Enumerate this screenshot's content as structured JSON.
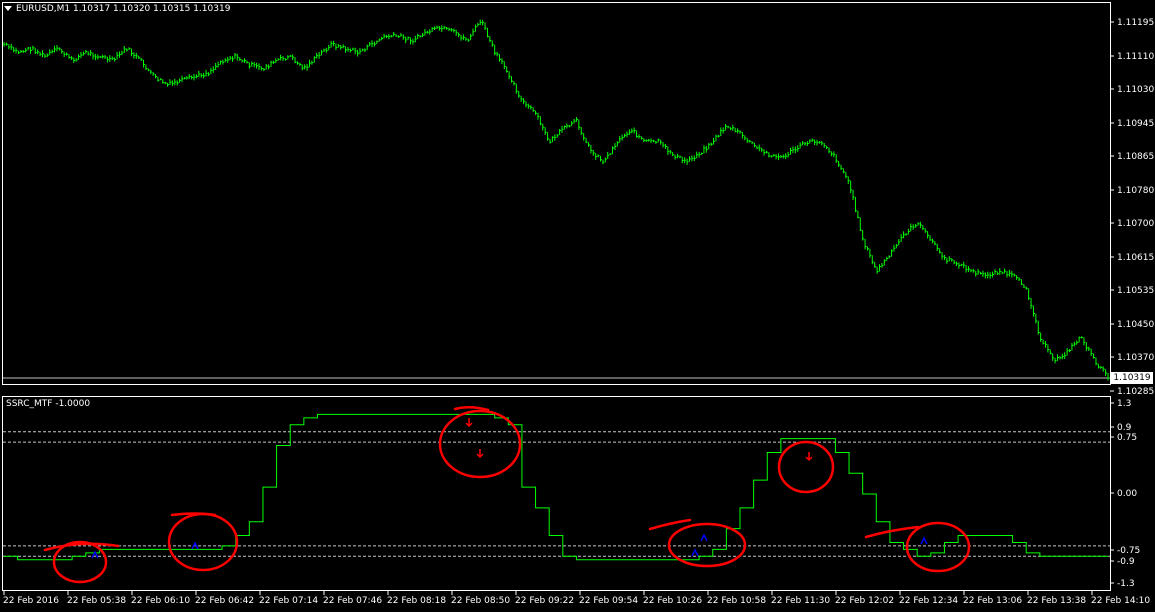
{
  "main_chart": {
    "symbol_header": "EURUSD,M1  1.10317 1.10320 1.10315 1.10319",
    "price_labels": [
      "1.11195",
      "1.11110",
      "1.11030",
      "1.10945",
      "1.10865",
      "1.10780",
      "1.10700",
      "1.10615",
      "1.10535",
      "1.10450",
      "1.10370",
      "1.10285"
    ],
    "current_price": "1.10319",
    "colors": {
      "background": "#000000",
      "candles": "#00ff00",
      "axis": "#ffffff"
    }
  },
  "indicator": {
    "title": "SSRC_MTF -1.0000",
    "levels_labels": [
      "1.3",
      "0.9",
      "0.75",
      "0.00",
      "-0.75",
      "-0.9",
      "-1.3"
    ],
    "line_color": "#00ff00",
    "arrow_up_color": "#0000ff",
    "arrow_down_color": "#ff0000",
    "annotation_color": "#ff0000"
  },
  "time_axis": {
    "labels": [
      "22 Feb 2016",
      "22 Feb 05:38",
      "22 Feb 06:10",
      "22 Feb 06:42",
      "22 Feb 07:14",
      "22 Feb 07:46",
      "22 Feb 08:18",
      "22 Feb 08:50",
      "22 Feb 09:22",
      "22 Feb 09:54",
      "22 Feb 10:26",
      "22 Feb 10:58",
      "22 Feb 11:30",
      "22 Feb 12:02",
      "22 Feb 12:34",
      "22 Feb 13:06",
      "22 Feb 13:38",
      "22 Feb 14:10"
    ]
  },
  "chart_data": [
    {
      "type": "line",
      "title": "EURUSD,M1",
      "series": [
        {
          "name": "EURUSD",
          "values": [
            1.1114,
            1.1112,
            1.1113,
            1.1111,
            1.1113,
            1.111,
            1.1112,
            1.1111,
            1.111,
            1.1113,
            1.111,
            1.1106,
            1.1104,
            1.1105,
            1.1106,
            1.1107,
            1.111,
            1.1111,
            1.1109,
            1.1108,
            1.111,
            1.1111,
            1.1108,
            1.1111,
            1.1114,
            1.1113,
            1.1112,
            1.1114,
            1.1116,
            1.1116,
            1.1115,
            1.1117,
            1.1118,
            1.1117,
            1.1115,
            1.112,
            1.1112,
            1.1107,
            1.11,
            1.1097,
            1.109,
            1.1093,
            1.1095,
            1.1088,
            1.1085,
            1.109,
            1.1093,
            1.109,
            1.109,
            1.1087,
            1.1085,
            1.1087,
            1.109,
            1.1094,
            1.1092,
            1.1089,
            1.1087,
            1.1086,
            1.1088,
            1.109,
            1.109,
            1.1086,
            1.108,
            1.1066,
            1.1058,
            1.1062,
            1.1067,
            1.107,
            1.1066,
            1.1061,
            1.106,
            1.1058,
            1.1057,
            1.1058,
            1.1057,
            1.1054,
            1.1042,
            1.1036,
            1.1038,
            1.1042,
            1.1036,
            1.1032
          ]
        }
      ],
      "ylim": [
        1.10285,
        1.11195
      ]
    },
    {
      "type": "line",
      "title": "SSRC_MTF -1.0000",
      "series": [
        {
          "name": "SSRC_MTF",
          "values": [
            -0.9,
            -0.95,
            -0.95,
            -0.95,
            -0.95,
            -0.9,
            -0.85,
            -0.8,
            -0.8,
            -0.8,
            -0.8,
            -0.8,
            -0.8,
            -0.8,
            -0.8,
            -0.8,
            -0.75,
            -0.6,
            -0.4,
            0.1,
            0.7,
            1.0,
            1.1,
            1.15,
            1.15,
            1.15,
            1.15,
            1.15,
            1.15,
            1.15,
            1.15,
            1.15,
            1.15,
            1.15,
            1.15,
            1.15,
            1.1,
            1.0,
            0.1,
            -0.2,
            -0.6,
            -0.9,
            -0.95,
            -0.95,
            -0.95,
            -0.95,
            -0.95,
            -0.95,
            -0.95,
            -0.95,
            -0.95,
            -0.9,
            -0.8,
            -0.5,
            -0.2,
            0.2,
            0.6,
            0.8,
            0.8,
            0.8,
            0.8,
            0.6,
            0.3,
            0.0,
            -0.4,
            -0.7,
            -0.8,
            -0.9,
            -0.85,
            -0.7,
            -0.6,
            -0.6,
            -0.6,
            -0.6,
            -0.7,
            -0.85,
            -0.9,
            -0.9,
            -0.9,
            -0.9,
            -0.9,
            -0.9
          ]
        }
      ],
      "levels": [
        0.9,
        0.75,
        -0.75,
        -0.9
      ],
      "ylim": [
        -1.3,
        1.3
      ]
    }
  ]
}
